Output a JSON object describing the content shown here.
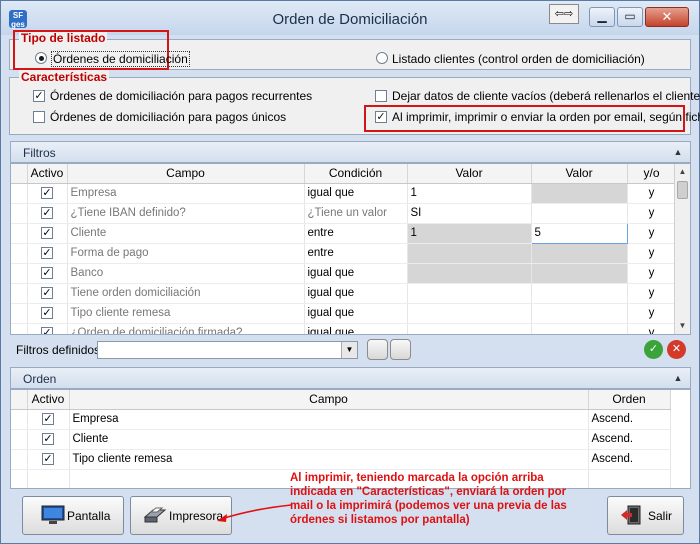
{
  "window": {
    "title": "Orden de Domiciliación"
  },
  "tipo_listado": {
    "title": "Tipo de listado",
    "option_ordenes": "Órdenes de domiciliación",
    "option_clientes": "Listado clientes (control orden de domiciliación)"
  },
  "caracteristicas": {
    "title": "Características",
    "recurrentes": "Órdenes de domiciliación para pagos recurrentes",
    "unicos": "Órdenes de domiciliación para pagos únicos",
    "datos_vacios": "Dejar datos de cliente vacíos (deberá rellenarlos el cliente)",
    "imprimir_email": "Al imprimir, imprimir o enviar la orden por email, según ficha"
  },
  "filtros": {
    "title": "Filtros",
    "headers": {
      "activo": "Activo",
      "campo": "Campo",
      "condicion": "Condición",
      "valor1": "Valor",
      "valor2": "Valor",
      "yo": "y/o"
    },
    "rows": [
      {
        "campo": "Empresa",
        "condicion": "igual que",
        "valor1": "1",
        "valor2": "",
        "yo": "y"
      },
      {
        "campo": "¿Tiene IBAN definido?",
        "condicion": "¿Tiene un valor",
        "valor1": "SI",
        "valor2": "",
        "yo": "y"
      },
      {
        "campo": "Cliente",
        "condicion": "entre",
        "valor1": "1",
        "valor2": "5",
        "yo": "y"
      },
      {
        "campo": "Forma de pago",
        "condicion": "entre",
        "valor1": "",
        "valor2": "",
        "yo": "y"
      },
      {
        "campo": "Banco",
        "condicion": "igual que",
        "valor1": "",
        "valor2": "",
        "yo": "y"
      },
      {
        "campo": "Tiene orden domiciliación",
        "condicion": "igual que",
        "valor1": "",
        "valor2": "",
        "yo": "y"
      },
      {
        "campo": "Tipo cliente remesa",
        "condicion": "igual que",
        "valor1": "",
        "valor2": "",
        "yo": "y"
      },
      {
        "campo": "¿Orden de domiciliación firmada?",
        "condicion": "igual que",
        "valor1": "",
        "valor2": "",
        "yo": "y"
      }
    ],
    "definidos_label": "Filtros definidos:"
  },
  "orden": {
    "title": "Orden",
    "headers": {
      "activo": "Activo",
      "campo": "Campo",
      "orden": "Orden"
    },
    "rows": [
      {
        "campo": "Empresa",
        "orden": "Ascend."
      },
      {
        "campo": "Cliente",
        "orden": "Ascend."
      },
      {
        "campo": "Tipo cliente remesa",
        "orden": "Ascend."
      }
    ]
  },
  "buttons": {
    "pantalla": "Pantalla",
    "impresora": "Impresora",
    "salir": "Salir"
  },
  "annotation": "Al imprimir, teniendo marcada la opción arriba indicada en \"Características\", enviará la orden por mail o la imprimirá (podemos ver una previa de las órdenes si listamos por pantalla)"
}
